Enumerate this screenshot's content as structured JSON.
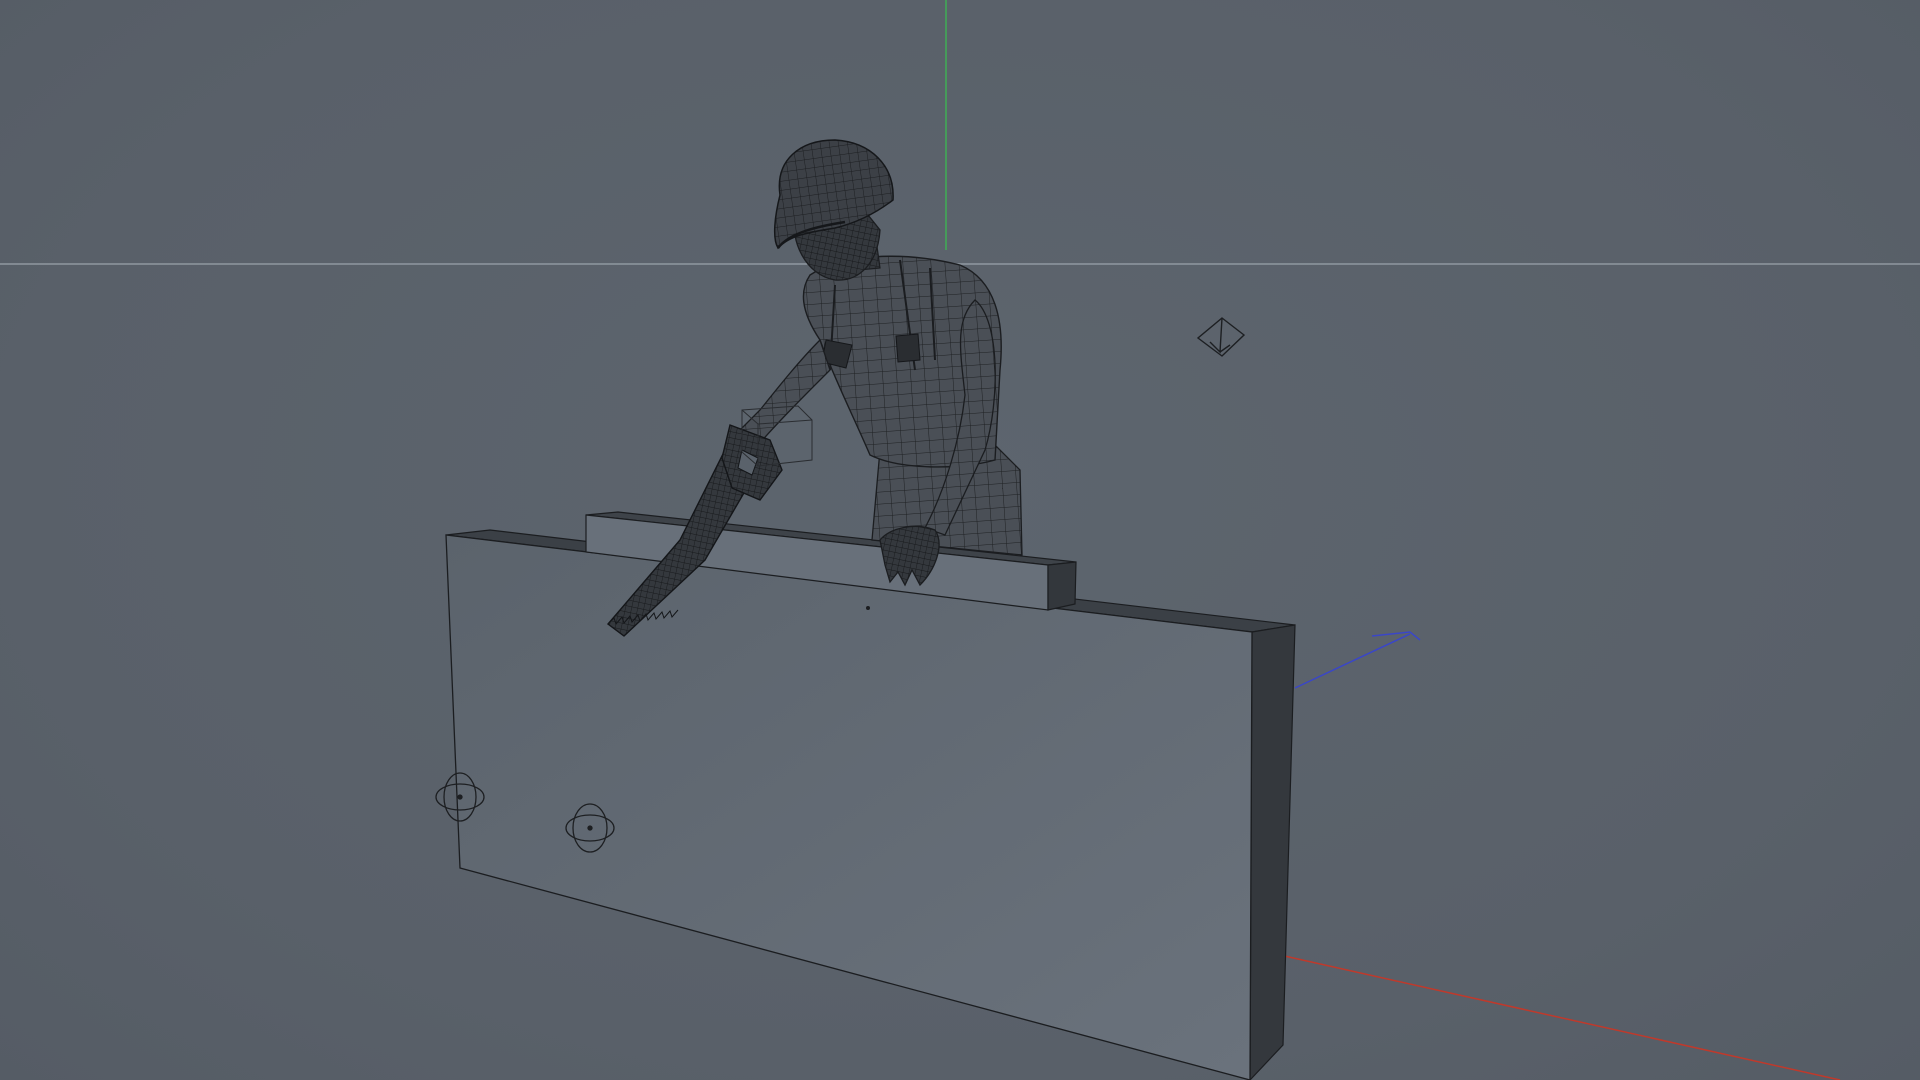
{
  "viewport": {
    "view_name": "perspective-viewport",
    "shading": "wireframe-on-shaded",
    "background_color": "#5a626b"
  },
  "colors": {
    "axis_x": "#c0392b",
    "axis_y": "#3fae55",
    "axis_z": "#3a46c8",
    "horizon": "#9aa3ab",
    "mesh_dark": "#26292d",
    "mesh_mid": "#3a3e44",
    "wire": "#1b1d20",
    "board_front": "#636b75",
    "board_side": "#34383d",
    "board_top": "#3b4046"
  },
  "objects": [
    {
      "id": "worker",
      "icon": "character-mesh"
    },
    {
      "id": "saw",
      "icon": "hand-saw-mesh"
    },
    {
      "id": "board",
      "icon": "box-mesh"
    },
    {
      "id": "plank",
      "icon": "box-mesh"
    },
    {
      "id": "light",
      "icon": "light-helper"
    },
    {
      "id": "control-left",
      "icon": "rotate-gizmo"
    },
    {
      "id": "control-right",
      "icon": "rotate-gizmo"
    }
  ]
}
